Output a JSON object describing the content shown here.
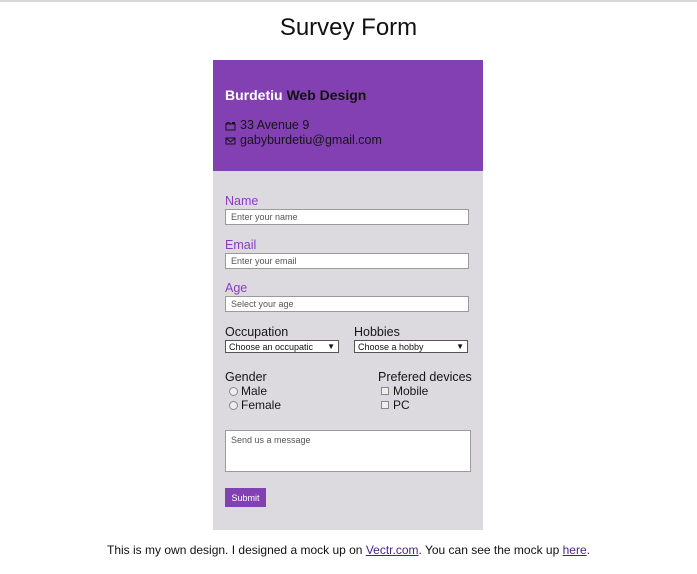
{
  "page": {
    "title": "Survey Form"
  },
  "header": {
    "brand_first": "Burdetiu",
    "brand_second": " Web Design",
    "address": "33 Avenue 9",
    "email": "gabyburdetiu@gmail.com",
    "address_icon": "mailbox-icon",
    "email_icon": "envelope-icon"
  },
  "form": {
    "name_label": "Name",
    "name_placeholder": "Enter your name",
    "email_label": "Email",
    "email_placeholder": "Enter your email",
    "age_label": "Age",
    "age_placeholder": "Select your age",
    "occupation_label": "Occupation",
    "occupation_value": "Choose an occupatic",
    "hobbies_label": "Hobbies",
    "hobbies_value": "Choose a hobby",
    "gender_label": "Gender",
    "gender_options": [
      "Male",
      "Female"
    ],
    "devices_label": "Prefered devices",
    "device_options": [
      "Mobile",
      "PC"
    ],
    "message_placeholder": "Send us a message",
    "submit_label": "Submit"
  },
  "footer": {
    "text1": "This is my own design. I designed a mock up on ",
    "link1": "Vectr.com",
    "text2": ". You can see the mock up ",
    "link2": "here",
    "text3": "."
  },
  "colors": {
    "accent": "#8340b2",
    "card_bg": "#dcdadf",
    "label_purple": "#8a3cc0"
  }
}
